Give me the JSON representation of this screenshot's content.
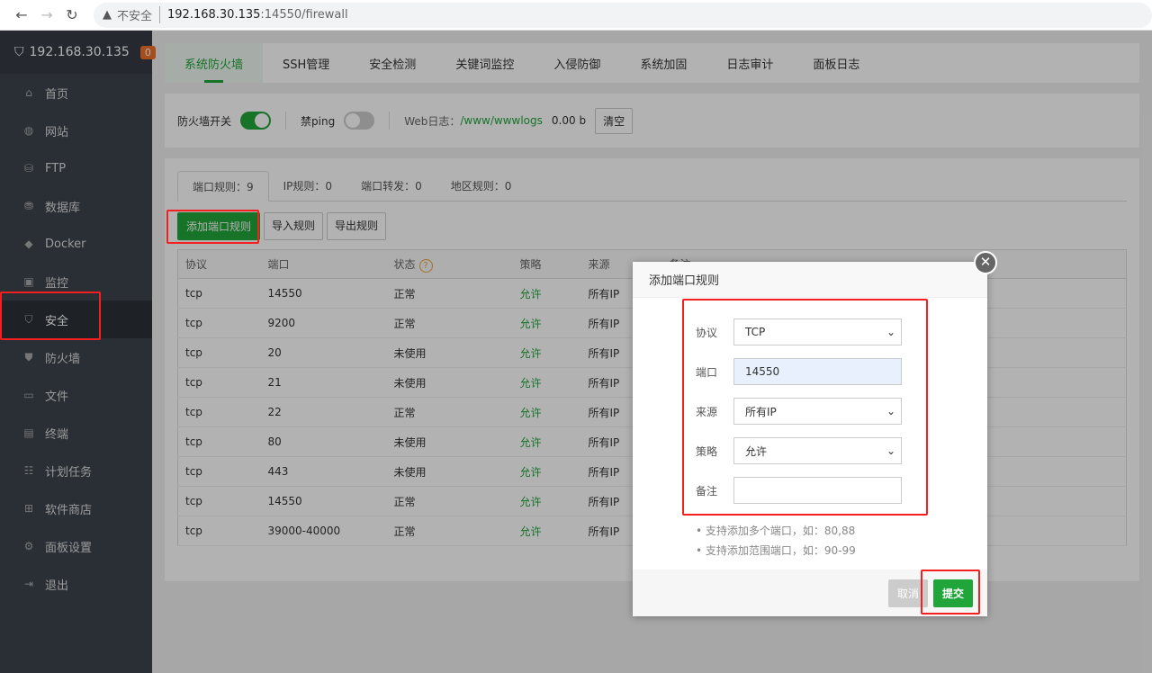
{
  "browser": {
    "insecure": "不安全",
    "host": "192.168.30.135",
    "path": ":14550/firewall"
  },
  "sidebar": {
    "server": "192.168.30.135",
    "badge": "0",
    "items": [
      {
        "label": "首页",
        "icon": "⌂"
      },
      {
        "label": "网站",
        "icon": "◍"
      },
      {
        "label": "FTP",
        "icon": "⛁"
      },
      {
        "label": "数据库",
        "icon": "⛃"
      },
      {
        "label": "Docker",
        "icon": "◆"
      },
      {
        "label": "监控",
        "icon": "▣"
      },
      {
        "label": "安全",
        "icon": "⛉"
      },
      {
        "label": "防火墙",
        "icon": "⛊"
      },
      {
        "label": "文件",
        "icon": "▭"
      },
      {
        "label": "终端",
        "icon": "▤"
      },
      {
        "label": "计划任务",
        "icon": "☷"
      },
      {
        "label": "软件商店",
        "icon": "⊞"
      },
      {
        "label": "面板设置",
        "icon": "⚙"
      },
      {
        "label": "退出",
        "icon": "⇥"
      }
    ]
  },
  "tabs": [
    "系统防火墙",
    "SSH管理",
    "安全检测",
    "关键词监控",
    "入侵防御",
    "系统加固",
    "日志审计",
    "面板日志"
  ],
  "bar": {
    "firewall_label": "防火墙开关",
    "ping_label": "禁ping",
    "weblog_label": "Web日志：",
    "weblog_path": "/www/wwwlogs",
    "weblog_size": "0.00 b",
    "clear": "清空"
  },
  "ptabs": [
    "端口规则：9",
    "IP规则：0",
    "端口转发：0",
    "地区规则：0"
  ],
  "actions": {
    "add": "添加端口规则",
    "import": "导入规则",
    "export": "导出规则"
  },
  "table": {
    "headers": [
      "协议",
      "端口",
      "状态",
      "策略",
      "来源",
      "备注"
    ],
    "rows": [
      [
        "tcp",
        "14550",
        "正常",
        "允许",
        "所有IP"
      ],
      [
        "tcp",
        "9200",
        "正常",
        "允许",
        "所有IP"
      ],
      [
        "tcp",
        "20",
        "未使用",
        "允许",
        "所有IP"
      ],
      [
        "tcp",
        "21",
        "未使用",
        "允许",
        "所有IP"
      ],
      [
        "tcp",
        "22",
        "正常",
        "允许",
        "所有IP"
      ],
      [
        "tcp",
        "80",
        "未使用",
        "允许",
        "所有IP"
      ],
      [
        "tcp",
        "443",
        "未使用",
        "允许",
        "所有IP"
      ],
      [
        "tcp",
        "14550",
        "正常",
        "允许",
        "所有IP"
      ],
      [
        "tcp",
        "39000-40000",
        "正常",
        "允许",
        "所有IP"
      ]
    ]
  },
  "modal": {
    "title": "添加端口规则",
    "protocol_label": "协议",
    "protocol": "TCP",
    "port_label": "端口",
    "port": "14550",
    "source_label": "来源",
    "source": "所有IP",
    "policy_label": "策略",
    "policy": "允许",
    "note_label": "备注",
    "note": "",
    "tip1": "支持添加多个端口，如：80,88",
    "tip2": "支持添加范围端口，如：90-99",
    "cancel": "取消",
    "submit": "提交"
  }
}
